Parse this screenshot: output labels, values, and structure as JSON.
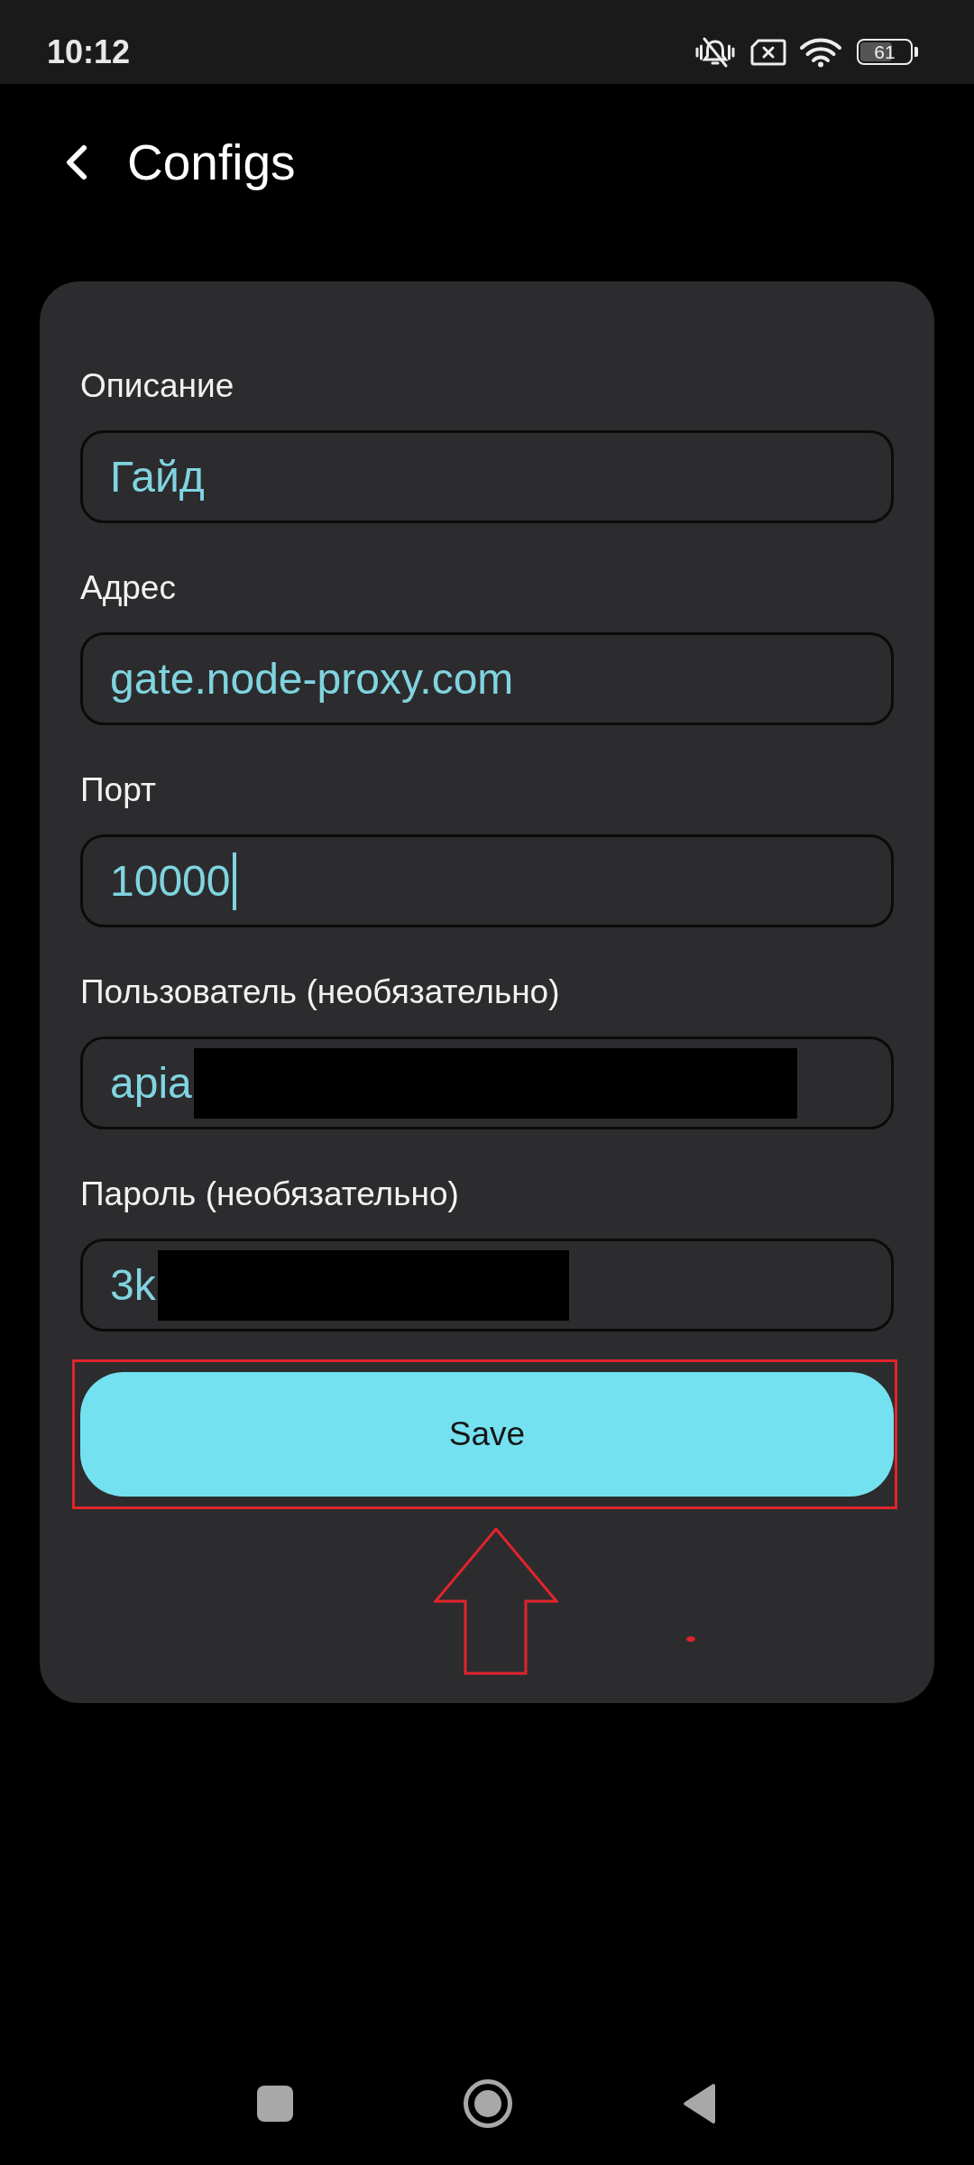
{
  "status_bar": {
    "time": "10:12",
    "battery": "61"
  },
  "header": {
    "title": "Configs"
  },
  "form": {
    "fields": [
      {
        "label": "Описание",
        "value": "Гайд",
        "focused": false,
        "redacted": false
      },
      {
        "label": "Адрес",
        "value": "gate.node-proxy.com",
        "focused": false,
        "redacted": false
      },
      {
        "label": "Порт",
        "value": "10000",
        "focused": true,
        "redacted": false
      },
      {
        "label": "Пользователь (необязательно)",
        "value": "apia",
        "focused": false,
        "redacted": true
      },
      {
        "label": "Пароль (необязательно)",
        "value": "3k",
        "focused": false,
        "redacted": true
      }
    ],
    "save_button": {
      "label": "Save"
    }
  }
}
